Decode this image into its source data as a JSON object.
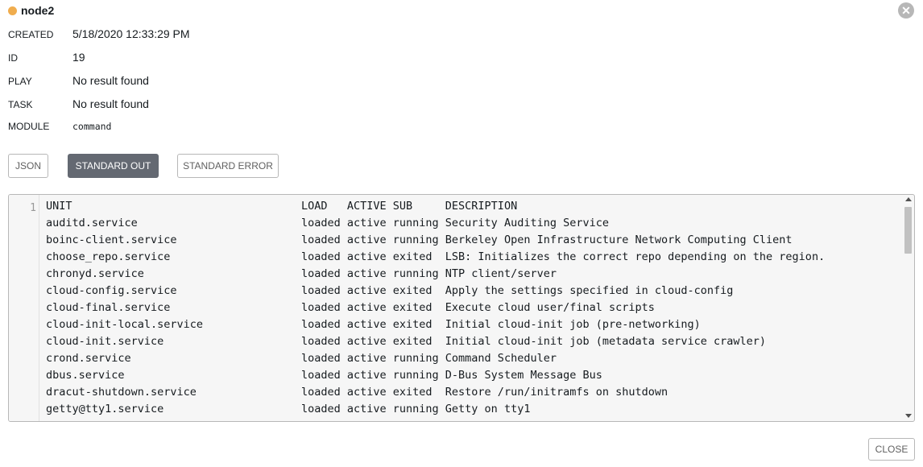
{
  "header": {
    "title": "node2",
    "status_color": "#f0ad4e",
    "close_icon": "close-circle-icon"
  },
  "details": [
    {
      "label": "CREATED",
      "value": "5/18/2020 12:33:29 PM"
    },
    {
      "label": "ID",
      "value": "19"
    },
    {
      "label": "PLAY",
      "value": "No result found"
    },
    {
      "label": "TASK",
      "value": "No result found"
    },
    {
      "label": "MODULE",
      "value": "command"
    }
  ],
  "tabs": [
    {
      "label": "JSON",
      "active": false
    },
    {
      "label": "STANDARD OUT",
      "active": true
    },
    {
      "label": "STANDARD ERROR",
      "active": false
    }
  ],
  "output": {
    "line_number": "1",
    "lines": [
      "UNIT                                   LOAD   ACTIVE SUB     DESCRIPTION",
      "auditd.service                         loaded active running Security Auditing Service",
      "boinc-client.service                   loaded active running Berkeley Open Infrastructure Network Computing Client",
      "choose_repo.service                    loaded active exited  LSB: Initializes the correct repo depending on the region.",
      "chronyd.service                        loaded active running NTP client/server",
      "cloud-config.service                   loaded active exited  Apply the settings specified in cloud-config",
      "cloud-final.service                    loaded active exited  Execute cloud user/final scripts",
      "cloud-init-local.service               loaded active exited  Initial cloud-init job (pre-networking)",
      "cloud-init.service                     loaded active exited  Initial cloud-init job (metadata service crawler)",
      "crond.service                          loaded active running Command Scheduler",
      "dbus.service                           loaded active running D-Bus System Message Bus",
      "dracut-shutdown.service                loaded active exited  Restore /run/initramfs on shutdown",
      "getty@tty1.service                     loaded active running Getty on tty1"
    ]
  },
  "footer": {
    "close_label": "CLOSE"
  }
}
